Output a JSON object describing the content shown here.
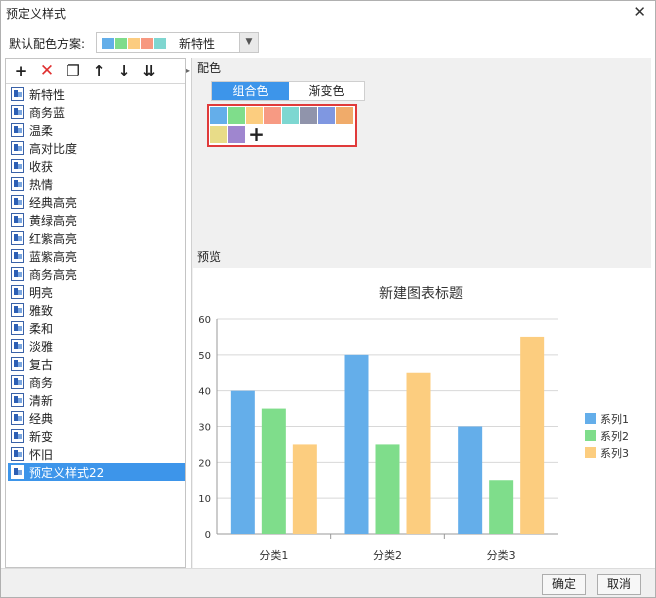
{
  "window": {
    "title": "预定义样式",
    "close_glyph": "✕"
  },
  "scheme": {
    "label": "默认配色方案:",
    "selected_name": "新特性",
    "swatches": [
      "#63aee9",
      "#7fdc8b",
      "#fccc80",
      "#f79880",
      "#7fd6d0"
    ]
  },
  "toolbar": [
    {
      "name": "add-icon",
      "glyph": "+"
    },
    {
      "name": "delete-icon",
      "glyph": "✕"
    },
    {
      "name": "copy-icon",
      "glyph": "❐"
    },
    {
      "name": "move-up-icon",
      "glyph": "↑"
    },
    {
      "name": "move-down-icon",
      "glyph": "↓"
    },
    {
      "name": "move-bottom-icon",
      "glyph": "⇊"
    }
  ],
  "styles": [
    "新特性",
    "商务蓝",
    "温柔",
    "高对比度",
    "收获",
    "热情",
    "经典高亮",
    "黄绿高亮",
    "红紫高亮",
    "蓝紫高亮",
    "商务高亮",
    "明亮",
    "雅致",
    "柔和",
    "淡雅",
    "复古",
    "商务",
    "清新",
    "经典",
    "新变",
    "怀旧",
    "预定义样式22"
  ],
  "selected_style_index": 21,
  "color_section": {
    "label": "配色",
    "tabs": [
      "组合色",
      "渐变色"
    ],
    "active_tab": 0,
    "palette": [
      "#64aeea",
      "#7fdd8b",
      "#fccd7f",
      "#f79a83",
      "#7dd7d1",
      "#9094ab",
      "#7f97e1",
      "#f0ab6a",
      "#e8dc88",
      "#9f86cf"
    ],
    "add_glyph": "+"
  },
  "preview": {
    "label": "预览"
  },
  "chart_data": {
    "type": "bar",
    "title": "新建图表标题",
    "categories": [
      "分类1",
      "分类2",
      "分类3"
    ],
    "series": [
      {
        "name": "系列1",
        "values": [
          40,
          50,
          30
        ],
        "color": "#64aeea"
      },
      {
        "name": "系列2",
        "values": [
          35,
          25,
          15
        ],
        "color": "#7fdd8b"
      },
      {
        "name": "系列3",
        "values": [
          25,
          45,
          55
        ],
        "color": "#fccd7f"
      }
    ],
    "ylim": [
      0,
      60
    ],
    "yticks": [
      0,
      10,
      20,
      30,
      40,
      50,
      60
    ],
    "grid": true,
    "legend": "right"
  },
  "buttons": {
    "ok": "确定",
    "cancel": "取消"
  }
}
